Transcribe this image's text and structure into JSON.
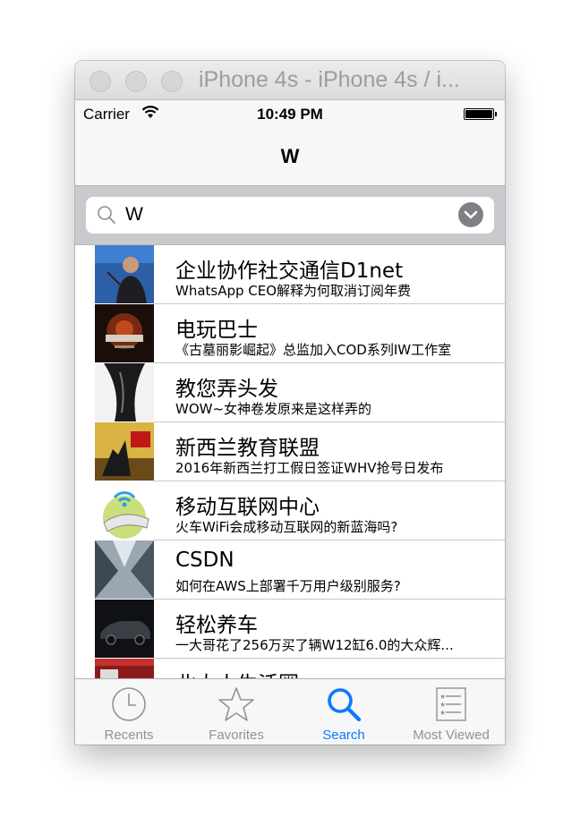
{
  "window": {
    "title": "iPhone 4s - iPhone 4s / i..."
  },
  "status_bar": {
    "carrier": "Carrier",
    "time": "10:49 PM"
  },
  "nav": {
    "title": "W"
  },
  "search": {
    "query": "W"
  },
  "results": [
    {
      "title": "企业协作社交通信D1net",
      "subtitle": "WhatsApp CEO解释为何取消订阅年费",
      "thumb": "speaker-on-stage"
    },
    {
      "title": "电玩巴士",
      "subtitle": "《古墓丽影崛起》总监加入COD系列IW工作室",
      "thumb": "call-of-duty-cover"
    },
    {
      "title": "教您弄头发",
      "subtitle": "WOW~女神卷发原来是这样弄的",
      "thumb": "long-hair"
    },
    {
      "title": "新西兰教育联盟",
      "subtitle": "2016年新西兰打工假日签证WHV抢号日发布",
      "thumb": "whv-poster"
    },
    {
      "title": "移动互联网中心",
      "subtitle": "火车WiFi会成移动互联网的新蓝海吗?",
      "thumb": "wifi-train"
    },
    {
      "title": "CSDN",
      "subtitle": "如何在AWS上部署千万用户级别服务?",
      "thumb": "skyscrapers"
    },
    {
      "title": "轻松养车",
      "subtitle": "一大哥花了256万买了辆W12缸6.0的大众辉...",
      "thumb": "dark-sedan"
    },
    {
      "title": "北大人生活圈",
      "subtitle": "",
      "thumb": "storefront"
    }
  ],
  "tabs": [
    {
      "label": "Recents",
      "icon": "clock-icon",
      "active": false
    },
    {
      "label": "Favorites",
      "icon": "star-icon",
      "active": false
    },
    {
      "label": "Search",
      "icon": "search-icon",
      "active": true
    },
    {
      "label": "Most Viewed",
      "icon": "list-icon",
      "active": false
    }
  ],
  "colors": {
    "accent": "#0a7aff",
    "inactive_tab": "#929292",
    "search_band": "#c9c9ce"
  }
}
